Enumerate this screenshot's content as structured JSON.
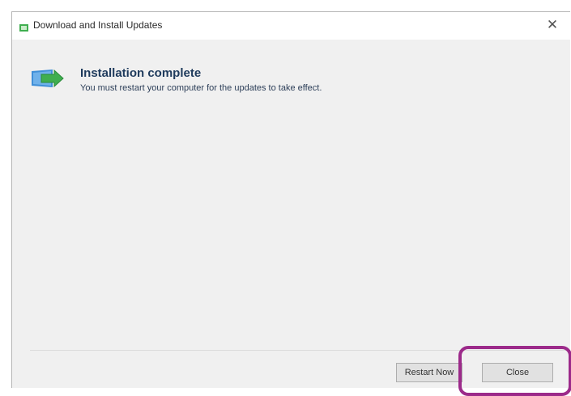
{
  "window": {
    "title": "Download and Install Updates"
  },
  "content": {
    "heading": "Installation complete",
    "message": "You must restart your computer for the updates to take effect."
  },
  "buttons": {
    "restart_label": "Restart Now",
    "close_label": "Close"
  },
  "icons": {
    "title_icon": "update-icon",
    "content_icon": "windows-update-icon",
    "close_icon": "close-icon"
  },
  "colors": {
    "highlight": "#9c2a8a",
    "icon_green": "#3fae4f",
    "icon_blue": "#3f8fd8"
  }
}
